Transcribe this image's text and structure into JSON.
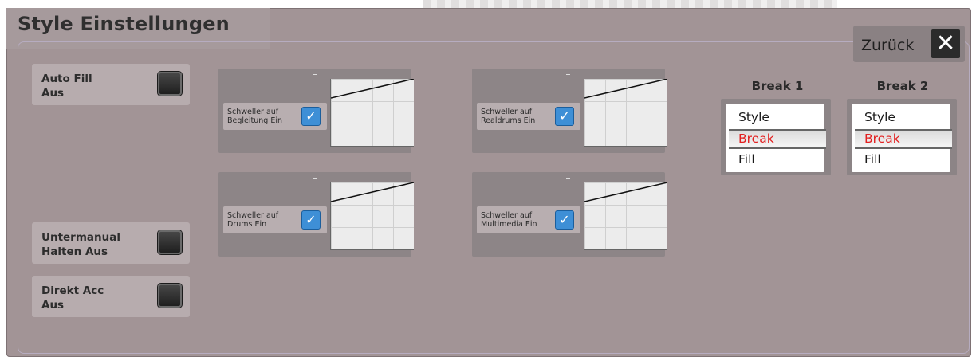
{
  "header": {
    "title": "Style Einstellungen"
  },
  "back_button": {
    "label": "Zurück",
    "icon": "close-icon"
  },
  "switches": [
    {
      "label": "Auto Fill\nAus"
    },
    {
      "label": "Untermanual\nHalten Aus"
    },
    {
      "label": "Direkt Acc\nAus"
    }
  ],
  "expression_panels": [
    {
      "label": "Schweller auf\nBegleitung Ein",
      "checked": true
    },
    {
      "label": "Schweller auf\nRealdrums Ein",
      "checked": true
    },
    {
      "label": "Schweller auf\nDrums Ein",
      "checked": true
    },
    {
      "label": "Schweller auf\nMultimedia Ein",
      "checked": true
    }
  ],
  "breaks": [
    {
      "title": "Break 1",
      "options": [
        "Style",
        "Break",
        "Fill"
      ],
      "selected": "Break"
    },
    {
      "title": "Break 2",
      "options": [
        "Style",
        "Break",
        "Fill"
      ],
      "selected": "Break"
    }
  ],
  "colors": {
    "accent_red": "#e21f1f",
    "checkbox_blue": "#3e8fd6"
  }
}
